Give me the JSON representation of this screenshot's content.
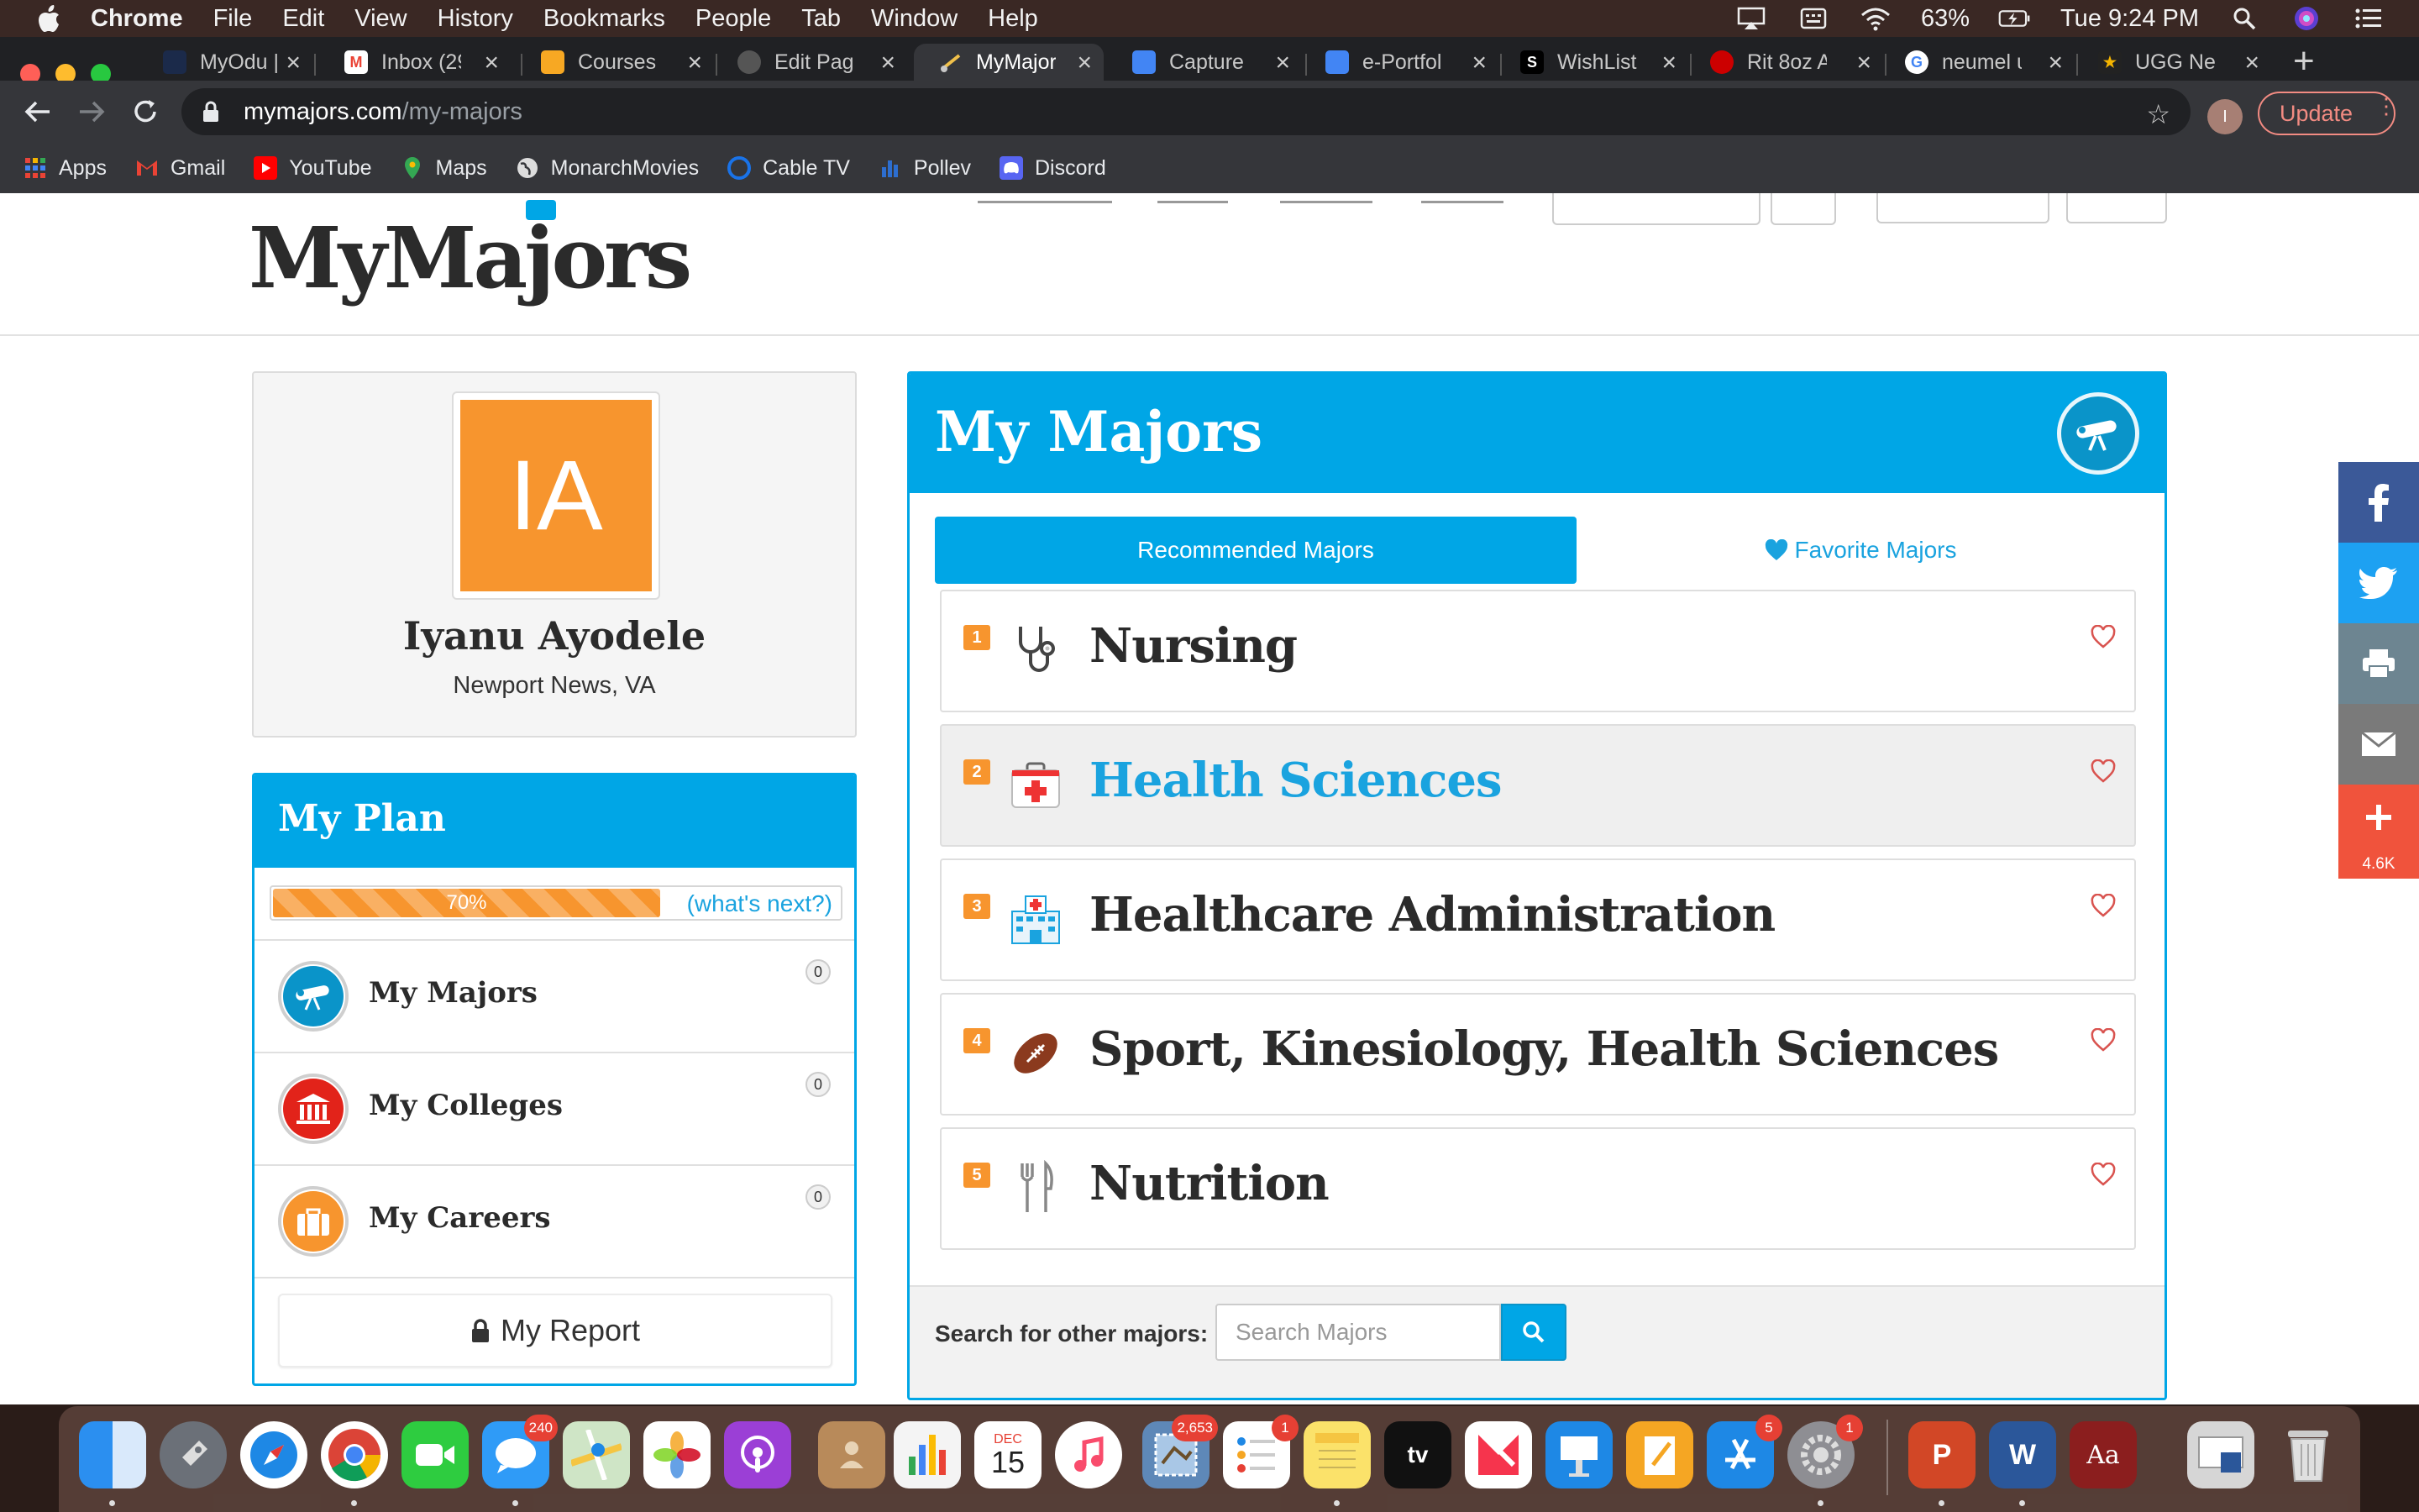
{
  "menubar": {
    "app_name": "Chrome",
    "items": [
      "File",
      "Edit",
      "View",
      "History",
      "Bookmarks",
      "People",
      "Tab",
      "Window",
      "Help"
    ],
    "battery": "63%",
    "clock": "Tue 9:24 PM"
  },
  "tabs": [
    {
      "title": "MyOdu |",
      "color": "#1b2a4a"
    },
    {
      "title": "Inbox (29",
      "color": "#ea4335",
      "glyph": "M"
    },
    {
      "title": "Courses",
      "color": "#f7a823"
    },
    {
      "title": "Edit Page",
      "color": "#666666"
    },
    {
      "title": "MyMajors",
      "color": "#35363a",
      "active": true
    },
    {
      "title": "Capture (",
      "color": "#4285f4"
    },
    {
      "title": "e-Portfoli",
      "color": "#4285f4"
    },
    {
      "title": "WishList",
      "color": "#111111",
      "glyph": "S"
    },
    {
      "title": "Rit 8oz A",
      "color": "#cc0000"
    },
    {
      "title": "neumel u",
      "color": "#ffffff",
      "glyph": "G"
    },
    {
      "title": "UGG Neu",
      "color": "#222222",
      "glyph": "★"
    }
  ],
  "toolbar": {
    "url_host": "mymajors.com",
    "url_path": "/my-majors",
    "profile_initial": "I",
    "update_label": "Update"
  },
  "bookmarks": [
    {
      "label": "Apps",
      "color": "#4285f4"
    },
    {
      "label": "Gmail",
      "color": "#ea4335"
    },
    {
      "label": "YouTube",
      "color": "#ff0000"
    },
    {
      "label": "Maps",
      "color": "#34a853"
    },
    {
      "label": "MonarchMovies",
      "color": "#dddddd"
    },
    {
      "label": "Cable TV",
      "color": "#1a73e8"
    },
    {
      "label": "Pollev",
      "color": "#2d6ecf"
    },
    {
      "label": "Discord",
      "color": "#5865f2"
    }
  ],
  "site": {
    "logo": "MyMajors"
  },
  "profile": {
    "initials": "IA",
    "name": "Iyanu Ayodele",
    "location": "Newport News, VA"
  },
  "plan": {
    "title": "My Plan",
    "progress_label": "70%",
    "progress": 0.7,
    "whats_next": "(what's next?)",
    "items": [
      {
        "label": "My Majors",
        "count": "0",
        "color": "#0a94c9"
      },
      {
        "label": "My Colleges",
        "count": "0",
        "color": "#e2231a"
      },
      {
        "label": "My Careers",
        "count": "0",
        "color": "#f7952e"
      }
    ],
    "report_label": "My Report"
  },
  "majors": {
    "title": "My Majors",
    "tab_recommended": "Recommended Majors",
    "tab_favorite": "Favorite Majors",
    "list": [
      {
        "rank": "1",
        "name": "Nursing",
        "icon": "stethoscope-icon"
      },
      {
        "rank": "2",
        "name": "Health Sciences",
        "icon": "first-aid-kit-icon",
        "highlight": true
      },
      {
        "rank": "3",
        "name": "Healthcare Administration",
        "icon": "hospital-icon"
      },
      {
        "rank": "4",
        "name": "Sport, Kinesiology, Health Sciences",
        "icon": "football-icon"
      },
      {
        "rank": "5",
        "name": "Nutrition",
        "icon": "fork-knife-icon"
      }
    ],
    "search_label": "Search for other majors:",
    "search_placeholder": "Search Majors"
  },
  "share": {
    "count": "4.6K",
    "colors": {
      "facebook": "#3b5998",
      "twitter": "#1da1f2",
      "print": "#6d8591",
      "email": "#7a7a7a",
      "more": "#f0533c"
    }
  },
  "dock": {
    "badges": {
      "messages": "240",
      "calendar_month": "DEC",
      "calendar_day": "15",
      "mail": "2,653",
      "reminders": "1",
      "appstore": "5",
      "settings": "1"
    }
  }
}
